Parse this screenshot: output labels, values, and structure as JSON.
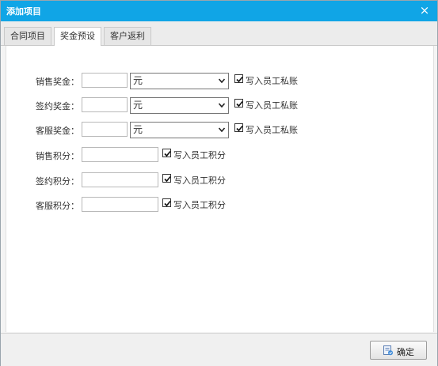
{
  "dialog": {
    "title": "添加项目",
    "close_symbol": "×"
  },
  "tabs": [
    {
      "label": "合同项目",
      "active": false
    },
    {
      "label": "奖金预设",
      "active": true
    },
    {
      "label": "客户返利",
      "active": false
    }
  ],
  "form": {
    "bonus_rows": [
      {
        "label": "销售奖金：",
        "value": "",
        "unit": "元",
        "check_label": "写入员工私账",
        "checked": true
      },
      {
        "label": "签约奖金：",
        "value": "",
        "unit": "元",
        "check_label": "写入员工私账",
        "checked": true
      },
      {
        "label": "客服奖金：",
        "value": "",
        "unit": "元",
        "check_label": "写入员工私账",
        "checked": true
      }
    ],
    "points_rows": [
      {
        "label": "销售积分：",
        "value": "",
        "check_label": "写入员工积分",
        "checked": true
      },
      {
        "label": "签约积分：",
        "value": "",
        "check_label": "写入员工积分",
        "checked": true
      },
      {
        "label": "客服积分：",
        "value": "",
        "check_label": "写入员工积分",
        "checked": true
      }
    ]
  },
  "footer": {
    "ok_label": "确定"
  },
  "colors": {
    "titlebar": "#10a5e6"
  }
}
